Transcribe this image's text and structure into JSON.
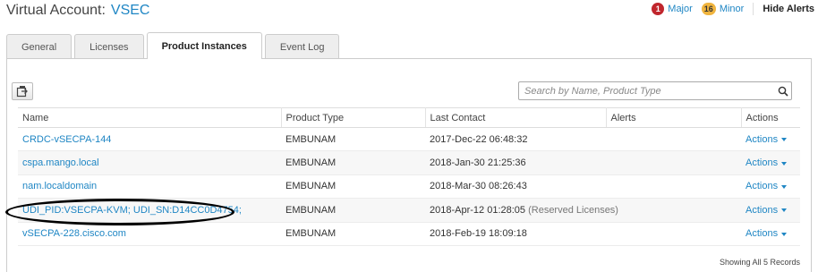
{
  "header": {
    "title_prefix": "Virtual Account:",
    "account_name": "VSEC"
  },
  "alerts": {
    "major_count": "1",
    "major_label": "Major",
    "minor_count": "16",
    "minor_label": "Minor",
    "hide_label": "Hide Alerts",
    "colors": {
      "major": "#c0262d",
      "minor": "#f0b43e"
    }
  },
  "tabs": [
    {
      "label": "General",
      "active": false
    },
    {
      "label": "Licenses",
      "active": false
    },
    {
      "label": "Product Instances",
      "active": true
    },
    {
      "label": "Event Log",
      "active": false
    }
  ],
  "toolbar": {
    "export_icon": "export-icon",
    "search_placeholder": "Search by Name, Product Type",
    "search_value": "",
    "search_icon": "search-icon"
  },
  "table": {
    "columns": [
      "Name",
      "Product Type",
      "Last Contact",
      "Alerts",
      "Actions"
    ],
    "rows": [
      {
        "name": "CRDC-vSECPA-144",
        "product_type": "EMBUNAM",
        "last_contact": "2017-Dec-22 06:48:32",
        "note": "",
        "alerts": "",
        "actions": "Actions"
      },
      {
        "name": "cspa.mango.local",
        "product_type": "EMBUNAM",
        "last_contact": "2018-Jan-30 21:25:36",
        "note": "",
        "alerts": "",
        "actions": "Actions"
      },
      {
        "name": "nam.localdomain",
        "product_type": "EMBUNAM",
        "last_contact": "2018-Mar-30 08:26:43",
        "note": "",
        "alerts": "",
        "actions": "Actions"
      },
      {
        "name": "UDI_PID:VSECPA-KVM; UDI_SN:D14CC0D4754;",
        "product_type": "EMBUNAM",
        "last_contact": "2018-Apr-12 01:28:05",
        "note": "(Reserved Licenses)",
        "alerts": "",
        "actions": "Actions"
      },
      {
        "name": "vSECPA-228.cisco.com",
        "product_type": "EMBUNAM",
        "last_contact": "2018-Feb-19 18:09:18",
        "note": "",
        "alerts": "",
        "actions": "Actions"
      }
    ]
  },
  "footer": {
    "records_text": "Showing All 5 Records"
  },
  "colors": {
    "link": "#1f86c4",
    "annotation": "#000000"
  }
}
